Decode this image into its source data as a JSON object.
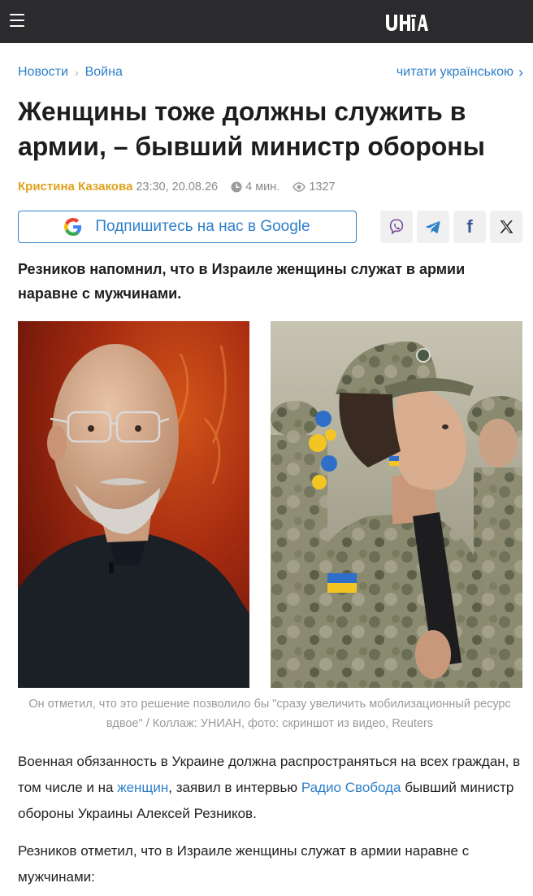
{
  "header": {
    "logo_text": "УНІАН",
    "menu_icon": "hamburger-menu-icon"
  },
  "breadcrumbs": {
    "items": [
      "Новости",
      "Война"
    ],
    "separator": "›"
  },
  "language_switch": {
    "label": "читати українською",
    "icon": "chevron-right-icon"
  },
  "article": {
    "title": "Женщины тоже должны служить в армии, – бывший министр обороны",
    "author": "Кристина Казакова",
    "datetime": "23:30, 20.08.26",
    "read_time": "4 мин.",
    "views": "1327",
    "lead": "Резников напомнил, что в Израиле женщины служат в армии наравне с мужчинами.",
    "caption": "Он отметил, что это решение позволило бы \"сразу увеличить мобилизационный ресурс вдвое\" / Коллаж: УНИАН, фото: скриншот из видео, Reuters",
    "p1": {
      "t1": "Военная обязанность в Украине должна распространяться на всех граждан, в том числе и на ",
      "link1": "женщин",
      "t2": ", заявил в интервью ",
      "link2": "Радио Свобода",
      "t3": " бывший министр обороны Украины Алексей Резников."
    },
    "p2": "Резников отметил, что в Израиле женщины служат в армии наравне с мужчинами:"
  },
  "google_subscribe": {
    "label": "Подпишитесь на нас в Google",
    "icon": "google-g-icon"
  },
  "share": [
    {
      "name": "viber",
      "icon": "viber-icon"
    },
    {
      "name": "telegram",
      "icon": "telegram-icon"
    },
    {
      "name": "facebook",
      "icon": "facebook-icon",
      "glyph": "f"
    },
    {
      "name": "x",
      "icon": "x-icon",
      "glyph": "𝕏"
    }
  ],
  "colors": {
    "topbar": "#2b2b2d",
    "accent": "#2f80c9",
    "author": "#e0a21b",
    "share_bg": "#f0f0f0"
  }
}
